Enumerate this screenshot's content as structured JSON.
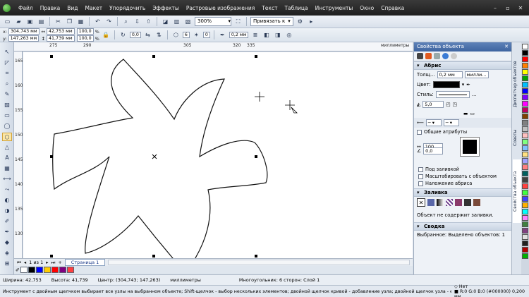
{
  "menu": {
    "items": [
      "Файл",
      "Правка",
      "Вид",
      "Макет",
      "Упорядочить",
      "Эффекты",
      "Растровые изображения",
      "Текст",
      "Таблица",
      "Инструменты",
      "Окно",
      "Справка"
    ],
    "window_buttons": [
      "–",
      "▫",
      "✕"
    ]
  },
  "toolbar": {
    "zoom_value": "300%",
    "snap_label": "Привязать к"
  },
  "propbar": {
    "x_label": "x:",
    "x_value": "304,743 мм",
    "y_label": "y:",
    "y_value": "147,263 мм",
    "width_value": "42,753 мм",
    "height_value": "41,739 мм",
    "scale_x": "100,0",
    "scale_y": "100,0",
    "pct": "%",
    "rotation": "0,0",
    "sides": "6",
    "sharpness": "0",
    "outline_width": "0,2 мм"
  },
  "rulers": {
    "top_ticks": [
      {
        "label": "275"
      },
      {
        "label": "290"
      },
      {
        "label": "305"
      },
      {
        "label": "320"
      },
      {
        "label": "335"
      }
    ],
    "top_unit": "миллиметры",
    "left_ticks": [
      "165",
      "160",
      "155",
      "150",
      "145",
      "140",
      "135",
      "130"
    ]
  },
  "nav": {
    "page_count": "1 из 1",
    "page_tab": "Страница 1"
  },
  "status": {
    "width": "Ширина: 42,753",
    "height": "Высота: 41,739",
    "center": "Центр: (304,743; 147,263)",
    "units": "миллиметры",
    "object_info": "Многоугольник: 6 сторон: Слой 1",
    "hint": "Инструмент с двойным щелчком выбирает все узлы на выбранном объекте; Shift-щелчок - выбор нескольких элементов; двойной щелчок кривой - добавление узла; двойной щелчок узла - его удаление",
    "fill_none": "Нет",
    "outline_info": "R:0 G:0 B:0 (#000000)  0,200 мм"
  },
  "docker": {
    "title": "Свойства объекта",
    "outline_section": "Абрис",
    "thickness_label": "Толщ...",
    "thickness_value": "0,2 мм",
    "thickness_unit": "милли...",
    "color_label": "Цвет:",
    "style_label": "Стиль:",
    "miter_value": "5,0",
    "common_attrs": "Общие атрибуты",
    "pct1": "100",
    "pct2": "0,0",
    "behind_fill": "Под заливкой",
    "scale_with_object": "Масштабировать с объектом",
    "overprint": "Наложение абриса",
    "fill_section": "Заливка",
    "no_fill_text": "Объект не содержит заливки.",
    "summary_section": "Сводка",
    "selected_text": "Выбранное: Выделено объектов: 1"
  },
  "side_tabs": [
    "Свойства объекта",
    "Советы",
    "Диспетчер объектов"
  ],
  "colors": {
    "accent": "#3e64a0",
    "palette": [
      "#ffffff",
      "#000000",
      "#ff0000",
      "#ff7f00",
      "#ffff00",
      "#00a000",
      "#00c0ff",
      "#0000ff",
      "#8000ff",
      "#ff00ff",
      "#c00060",
      "#804000",
      "#808080",
      "#c0c0c0",
      "#ffc0c0",
      "#80ff80",
      "#80c0ff",
      "#ffe080",
      "#a0a0ff",
      "#ff8080",
      "#006060",
      "#404040",
      "#ff4040",
      "#40ff40",
      "#4040ff",
      "#ffb000",
      "#00ffff",
      "#ff80ff",
      "#408040",
      "#804080",
      "#e0e0e0",
      "#202020",
      "#b00000",
      "#00b000"
    ],
    "bottom_swatches": [
      "#ffffff",
      "#000000",
      "#0000ff",
      "#ffcc00",
      "#ff0000",
      "#800080",
      "#ff4040"
    ]
  }
}
